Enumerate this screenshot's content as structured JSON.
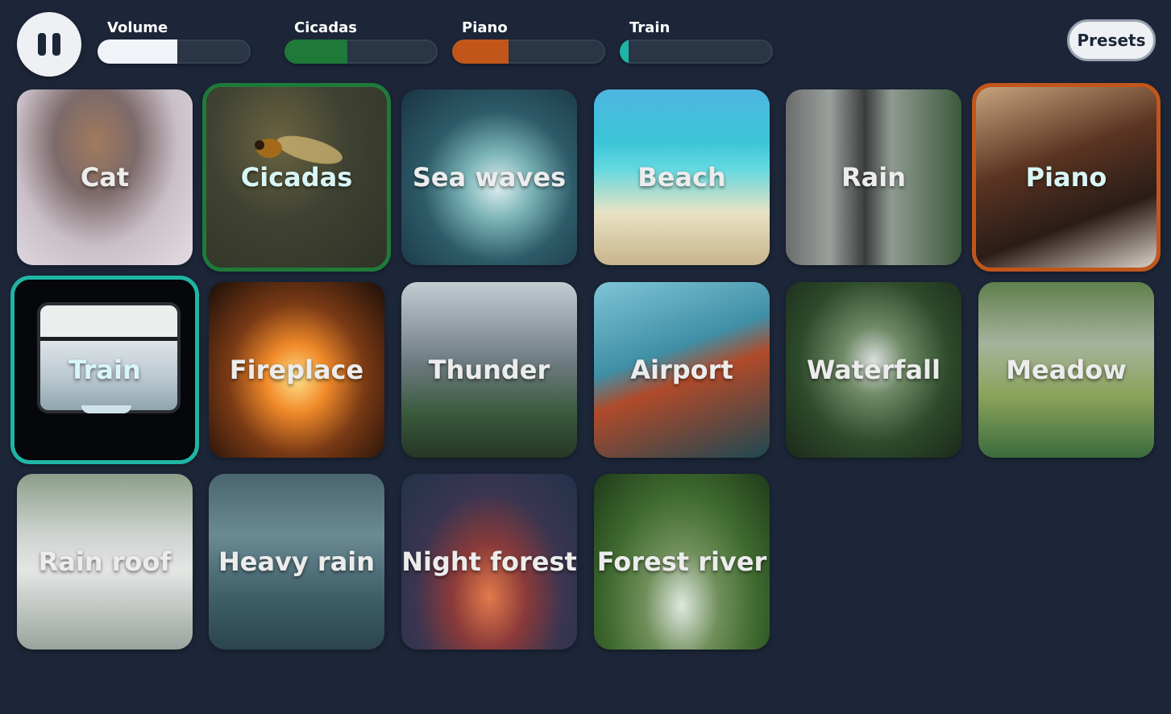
{
  "controls": {
    "play_state": "pause-icon",
    "sliders": [
      {
        "label": "Volume",
        "level": 0.52,
        "color": "#f0f3f8"
      },
      {
        "label": "Cicadas",
        "level": 0.41,
        "color": "#1f7a3a"
      },
      {
        "label": "Piano",
        "level": 0.37,
        "color": "#c2561a"
      },
      {
        "label": "Train",
        "level": 0.06,
        "color": "#1fb5a6"
      }
    ],
    "presets_label": "Presets"
  },
  "sounds": [
    {
      "label": "Cat",
      "active": false
    },
    {
      "label": "Cicadas",
      "active": true,
      "accent": "#1f7a3a"
    },
    {
      "label": "Sea waves",
      "active": false
    },
    {
      "label": "Beach",
      "active": false
    },
    {
      "label": "Rain",
      "active": false
    },
    {
      "label": "Piano",
      "active": true,
      "accent": "#c2561a"
    },
    {
      "label": "Train",
      "active": true,
      "accent": "#1fb5a6"
    },
    {
      "label": "Fireplace",
      "active": false
    },
    {
      "label": "Thunder",
      "active": false
    },
    {
      "label": "Airport",
      "active": false
    },
    {
      "label": "Waterfall",
      "active": false
    },
    {
      "label": "Meadow",
      "active": false
    },
    {
      "label": "Rain roof",
      "active": false
    },
    {
      "label": "Heavy rain",
      "active": false
    },
    {
      "label": "Night forest",
      "active": false
    },
    {
      "label": "Forest river",
      "active": false
    }
  ]
}
